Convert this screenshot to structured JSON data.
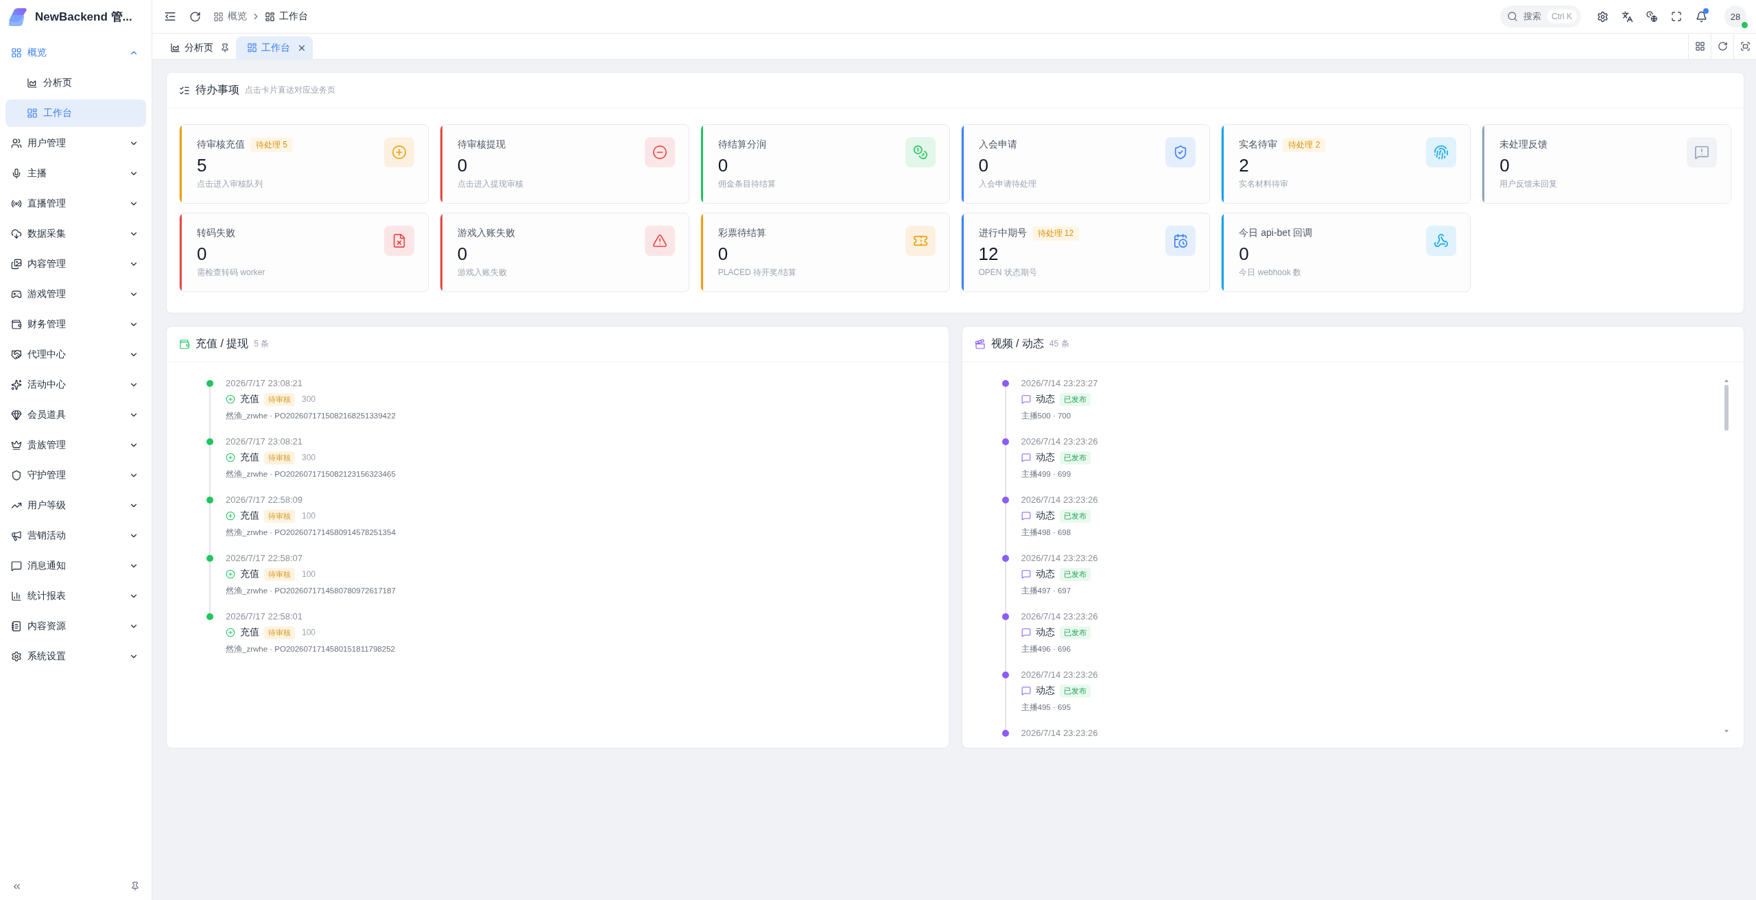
{
  "brand": {
    "name": "NewBackend 管..."
  },
  "sidebar": {
    "items": [
      {
        "label": "概览",
        "expanded": true,
        "children": [
          {
            "label": "分析页",
            "selected": false
          },
          {
            "label": "工作台",
            "selected": true
          }
        ]
      },
      {
        "label": "用户管理",
        "expanded": false
      },
      {
        "label": "主播",
        "expanded": false
      },
      {
        "label": "直播管理",
        "expanded": false
      },
      {
        "label": "数据采集",
        "expanded": false
      },
      {
        "label": "内容管理",
        "expanded": false
      },
      {
        "label": "游戏管理",
        "expanded": false
      },
      {
        "label": "财务管理",
        "expanded": false
      },
      {
        "label": "代理中心",
        "expanded": false
      },
      {
        "label": "活动中心",
        "expanded": false
      },
      {
        "label": "会员道具",
        "expanded": false
      },
      {
        "label": "贵族管理",
        "expanded": false
      },
      {
        "label": "守护管理",
        "expanded": false
      },
      {
        "label": "用户等级",
        "expanded": false
      },
      {
        "label": "营销活动",
        "expanded": false
      },
      {
        "label": "消息通知",
        "expanded": false
      },
      {
        "label": "统计报表",
        "expanded": false
      },
      {
        "label": "内容资源",
        "expanded": false
      },
      {
        "label": "系统设置",
        "expanded": false
      }
    ]
  },
  "header": {
    "breadcrumb": [
      {
        "label": "概览"
      },
      {
        "label": "工作台"
      }
    ],
    "search": {
      "label": "搜索",
      "shortcut": "Ctrl K"
    },
    "notifications": {
      "unread": true
    },
    "avatar": {
      "text": "28",
      "online": true
    }
  },
  "tabs": [
    {
      "label": "分析页",
      "pinned": true,
      "selected": false
    },
    {
      "label": "工作台",
      "pinned": false,
      "selected": true
    }
  ],
  "todo": {
    "title": "待办事项",
    "subtitle": "点击卡片直达对应业务页",
    "cards": [
      {
        "title": "待审核充值",
        "badge": "待处理 5",
        "value": "5",
        "description": "点击进入审核队列",
        "color": "#f59e0b"
      },
      {
        "title": "待审核提现",
        "value": "0",
        "description": "点击进入提现审核",
        "color": "#ef4444"
      },
      {
        "title": "待结算分润",
        "value": "0",
        "description": "佣金条目待结算",
        "color": "#22c55e"
      },
      {
        "title": "入会申请",
        "value": "0",
        "description": "入会申请待处理",
        "color": "#3b82f6"
      },
      {
        "title": "实名待审",
        "badge": "待处理 2",
        "value": "2",
        "description": "实名材料待审",
        "color": "#0ea5e9"
      },
      {
        "title": "未处理反馈",
        "value": "0",
        "description": "用户反馈未回复",
        "color": "#94a3b8"
      },
      {
        "title": "转码失败",
        "value": "0",
        "description": "需检查转码 worker",
        "color": "#ef4444"
      },
      {
        "title": "游戏入账失败",
        "value": "0",
        "description": "游戏入账失败",
        "color": "#ef4444"
      },
      {
        "title": "彩票待结算",
        "value": "0",
        "description": "PLACED 待开奖/结算",
        "color": "#f59e0b"
      },
      {
        "title": "进行中期号",
        "badge": "待处理 12",
        "value": "12",
        "description": "OPEN 状态期号",
        "color": "#3b82f6"
      },
      {
        "title": "今日 api-bet 回调",
        "value": "0",
        "description": "今日 webhook 数",
        "color": "#0ea5e9"
      }
    ]
  },
  "panels": [
    {
      "kind": "finance",
      "title": "充值 / 提现",
      "count": "5 条",
      "color": "#22c55e",
      "items": [
        {
          "time": "2026/7/17 23:08:21",
          "type": "充值",
          "status": "待审核",
          "amount": "300",
          "detail": "然渔_zrwhe · PO2026071715082168251339422"
        },
        {
          "time": "2026/7/17 23:08:21",
          "type": "充值",
          "status": "待审核",
          "amount": "300",
          "detail": "然渔_zrwhe · PO2026071715082123156323465"
        },
        {
          "time": "2026/7/17 22:58:09",
          "type": "充值",
          "status": "待审核",
          "amount": "100",
          "detail": "然渔_zrwhe · PO2026071714580914578251354"
        },
        {
          "time": "2026/7/17 22:58:07",
          "type": "充值",
          "status": "待审核",
          "amount": "100",
          "detail": "然渔_zrwhe · PO2026071714580780972617187"
        },
        {
          "time": "2026/7/17 22:58:01",
          "type": "充值",
          "status": "待审核",
          "amount": "100",
          "detail": "然渔_zrwhe · PO2026071714580151811798252"
        }
      ]
    },
    {
      "kind": "content",
      "title": "视频 / 动态",
      "count": "45 条",
      "color": "#8b5cf6",
      "items": [
        {
          "time": "2026/7/14 23:23:27",
          "type": "动态",
          "status": "已发布",
          "detail": "主播500 · 700"
        },
        {
          "time": "2026/7/14 23:23:26",
          "type": "动态",
          "status": "已发布",
          "detail": "主播499 · 699"
        },
        {
          "time": "2026/7/14 23:23:26",
          "type": "动态",
          "status": "已发布",
          "detail": "主播498 · 698"
        },
        {
          "time": "2026/7/14 23:23:26",
          "type": "动态",
          "status": "已发布",
          "detail": "主播497 · 697"
        },
        {
          "time": "2026/7/14 23:23:26",
          "type": "动态",
          "status": "已发布",
          "detail": "主播496 · 696"
        },
        {
          "time": "2026/7/14 23:23:26",
          "type": "动态",
          "status": "已发布",
          "detail": "主播495 · 695"
        },
        {
          "time": "2026/7/14 23:23:26"
        }
      ]
    }
  ]
}
